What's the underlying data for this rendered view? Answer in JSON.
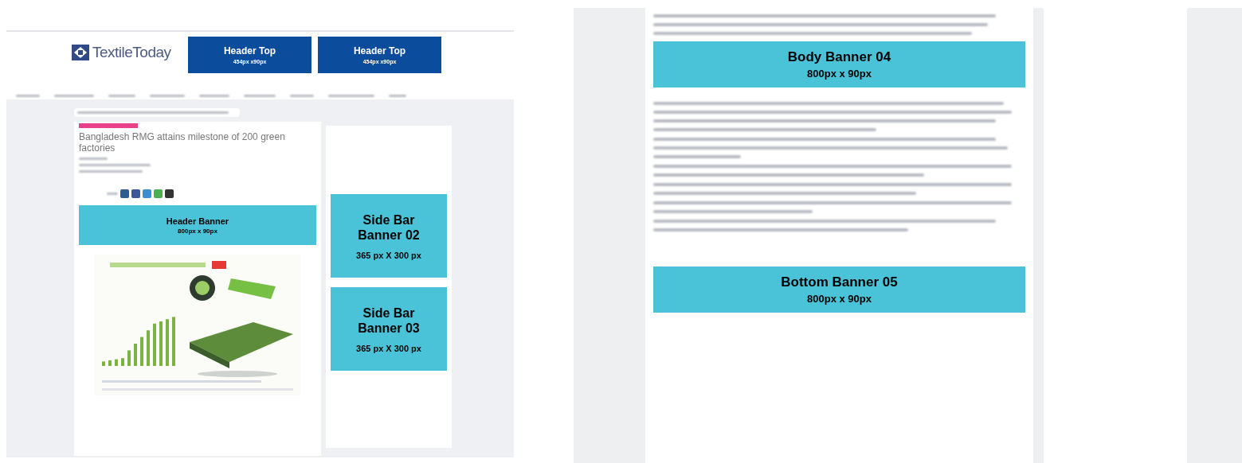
{
  "left_page": {
    "logo": "TextileToday",
    "header_ads": [
      {
        "title": "Header Top",
        "size": "454px x90px"
      },
      {
        "title": "Header Top",
        "size": "454px x90px"
      }
    ],
    "article_title": "Bangladesh RMG attains milestone of 200 green factories",
    "header_banner": {
      "title": "Header Banner",
      "size": "800px x 90px"
    },
    "sidebar_ads": [
      {
        "title": "Side Bar Banner 02",
        "size": "365 px X 300 px"
      },
      {
        "title": "Side Bar Banner 03",
        "size": "365 px X 300 px"
      }
    ]
  },
  "right_page": {
    "body_banner": {
      "title": "Body Banner 04",
      "size": "800px x 90px"
    },
    "bottom_banner": {
      "title": "Bottom Banner 05",
      "size": "800px x 90px"
    }
  }
}
